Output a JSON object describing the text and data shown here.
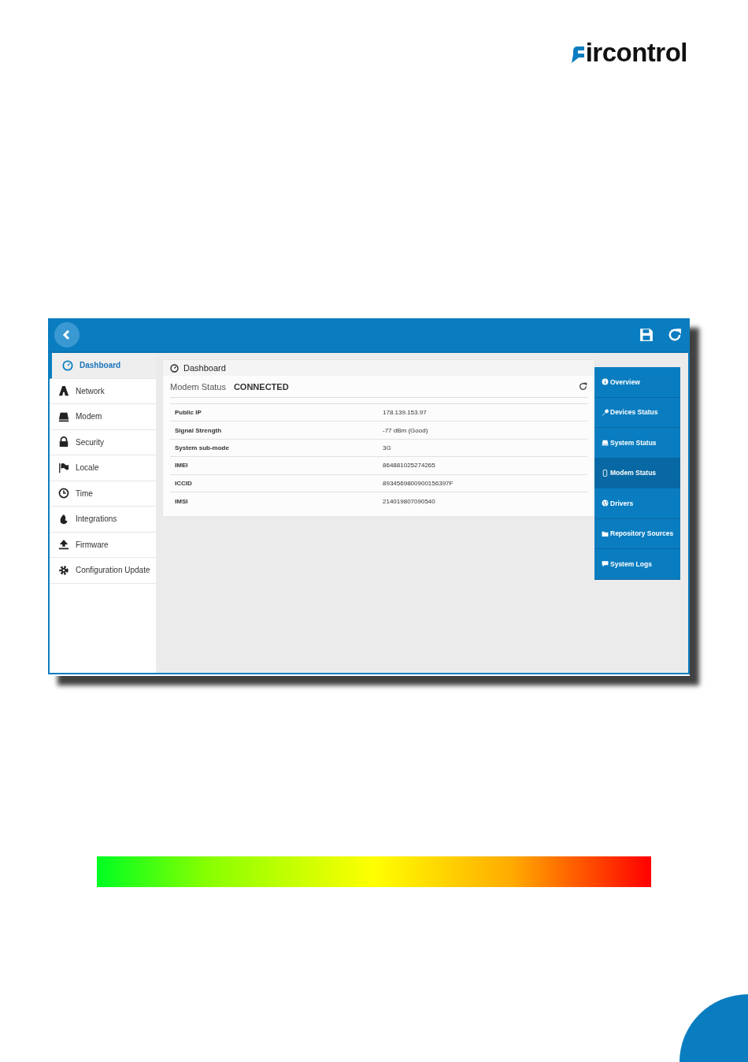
{
  "logo": {
    "text": "ircontrol"
  },
  "app": {
    "sidebar": {
      "items": [
        {
          "label": "Dashboard",
          "selected": true
        },
        {
          "label": "Network",
          "selected": false
        },
        {
          "label": "Modem",
          "selected": false
        },
        {
          "label": "Security",
          "selected": false
        },
        {
          "label": "Locale",
          "selected": false
        },
        {
          "label": "Time",
          "selected": false
        },
        {
          "label": "Integrations",
          "selected": false
        },
        {
          "label": "Firmware",
          "selected": false
        },
        {
          "label": "Configuration Update",
          "selected": false
        }
      ]
    },
    "panel": {
      "title": "Dashboard",
      "status_label": "Modem Status",
      "status_value": "CONNECTED",
      "rows": [
        {
          "label": "Public IP",
          "value": "178.139.153.97"
        },
        {
          "label": "Signal Strength",
          "value": "-77 dBm (Good)"
        },
        {
          "label": "System sub-mode",
          "value": "3G"
        },
        {
          "label": "IMEI",
          "value": "864881025274265"
        },
        {
          "label": "ICCID",
          "value": "8934569800900156397F"
        },
        {
          "label": "IMSI",
          "value": "214019807090540"
        }
      ]
    },
    "status_nav": {
      "items": [
        {
          "label": "Overview",
          "selected": false
        },
        {
          "label": "Devices Status",
          "selected": false
        },
        {
          "label": "System Status",
          "selected": false
        },
        {
          "label": "Modem Status",
          "selected": true
        },
        {
          "label": "Drivers",
          "selected": false
        },
        {
          "label": "Repository Sources",
          "selected": false
        },
        {
          "label": "System Logs",
          "selected": false
        }
      ]
    }
  }
}
